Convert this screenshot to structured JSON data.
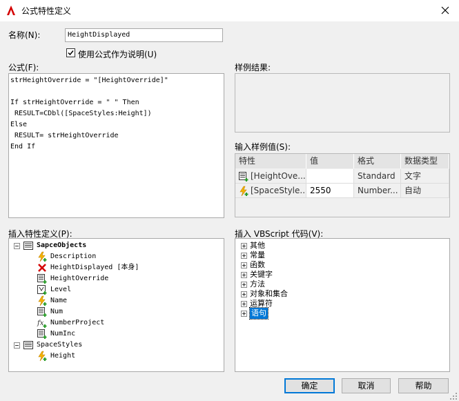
{
  "window": {
    "title": "公式特性定义"
  },
  "name_field": {
    "label": "名称(N):",
    "value": "HeightDisplayed"
  },
  "use_formula_description": {
    "label": "使用公式作为说明(U)",
    "checked": true
  },
  "formula": {
    "label": "公式(F):",
    "lines": [
      "strHeightOverride = \"[HeightOverride]\"",
      "",
      "If strHeightOverride = \" \" Then",
      " RESULT=CDbl([SpaceStyles:Height])",
      "Else",
      " RESULT= strHeightOverride",
      "End If"
    ]
  },
  "sample_result": {
    "label": "样例结果:"
  },
  "sample_values": {
    "label": "输入样例值(S):",
    "columns": [
      "特性",
      "值",
      "格式",
      "数据类型"
    ],
    "rows": [
      {
        "property": "[HeightOve...",
        "value": "",
        "format": "Standard",
        "type": "文字",
        "icon": "property-list-icon"
      },
      {
        "property": "[SpaceStyle...",
        "value": "2550",
        "format": "Number...",
        "type": "自动",
        "icon": "lightning-icon"
      }
    ]
  },
  "insert_property": {
    "label": "插入特性定义(P):",
    "tree": [
      {
        "label": "SapceObjects",
        "level": 0,
        "expanded": true,
        "icon": "property-set-icon",
        "bold": true
      },
      {
        "label": "Description",
        "level": 1,
        "icon": "lightning-icon"
      },
      {
        "label": "HeightDisplayed [本身]",
        "level": 1,
        "icon": "red-x-icon"
      },
      {
        "label": "HeightOverride",
        "level": 1,
        "icon": "property-list-icon"
      },
      {
        "label": "Level",
        "level": 1,
        "icon": "level-icon"
      },
      {
        "label": "Name",
        "level": 1,
        "icon": "lightning-icon"
      },
      {
        "label": "Num",
        "level": 1,
        "icon": "property-list-icon"
      },
      {
        "label": "NumberProject",
        "level": 1,
        "icon": "formula-icon"
      },
      {
        "label": "NumInc",
        "level": 1,
        "icon": "property-list-icon"
      },
      {
        "label": "SpaceStyles",
        "level": 0,
        "expanded": true,
        "icon": "property-set-icon"
      },
      {
        "label": "Height",
        "level": 1,
        "icon": "lightning-icon"
      }
    ]
  },
  "vbscript": {
    "label": "插入 VBScript 代码(V):",
    "items": [
      "其他",
      "常量",
      "函数",
      "关键字",
      "方法",
      "对象和集合",
      "运算符",
      "语句"
    ],
    "selected_index": 7
  },
  "buttons": {
    "ok": "确定",
    "cancel": "取消",
    "help": "帮助"
  },
  "colors": {
    "accent": "#0078d7",
    "selection": "#0078d7",
    "brand_red": "#d40000"
  }
}
